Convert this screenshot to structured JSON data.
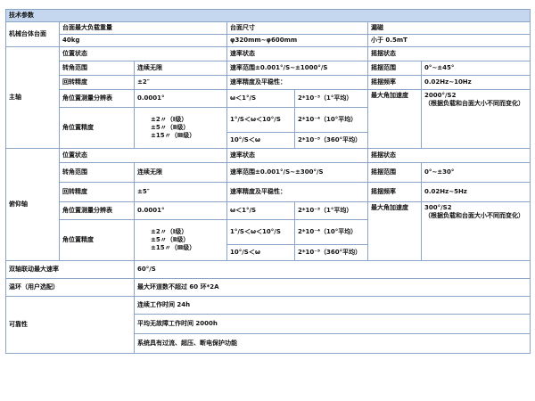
{
  "title": "技术参数",
  "mech": {
    "label": "机械台体台面",
    "load_h": "台面最大负载重量",
    "load_v": "40kg",
    "size_h": "台面尺寸",
    "size_v": "φ320mm~φ600mm",
    "mag_h": "漏磁",
    "mag_v": "小于 0.5mT"
  },
  "main": {
    "label": "主轴",
    "pos_state": "位置状态",
    "rate_state": "速率状态",
    "swing_state": "摇摆状态",
    "angle_range": "转角范围",
    "angle_range_v": "连续无限",
    "rate_range": "速率范围±0.001°/S~±1000°/S",
    "swing_range": "摇摆范围",
    "swing_range_v": "0°~±45°",
    "return_acc": "回转精度",
    "return_acc_v": "±2″",
    "rate_stab": "速率精度及平稳性：",
    "swing_freq": "摇摆频率",
    "swing_freq_v": "0.02Hz~10Hz",
    "pos_res": "角位置测量分辨表",
    "pos_res_v": "0.0001°",
    "r1_cond": "ω＜1°/S",
    "r1_val": "2*10⁻³（1°平均）",
    "max_acc": "最大角加速度",
    "max_acc_v1": "2000°/S2",
    "max_acc_v2": "（根据负载和台面大小不同而变化）",
    "pos_acc": "角位置精度",
    "pos_acc_l1": "±2〃（Ⅰ级）",
    "pos_acc_l2": "±5〃（Ⅱ级）",
    "pos_acc_l3": "±15〃（Ⅲ级）",
    "r2_cond": "1°/S＜ω＜10°/S",
    "r2_val": "2*10⁻⁴（10°平均）",
    "r3_cond": "10°/S＜ω",
    "r3_val": "2*10⁻⁵（360°平均）"
  },
  "pitch": {
    "label": "俯仰轴",
    "pos_state": "位置状态",
    "rate_state": "速率状态",
    "swing_state": "摇摆状态",
    "angle_range": "转角范围",
    "angle_range_v": "连续无限",
    "rate_range": "速率范围±0.001°/S~±300°/S",
    "swing_range": "摇摆范围",
    "swing_range_v": "0°~±30°",
    "return_acc": "回转精度",
    "return_acc_v": "±5″",
    "rate_stab": "速率精度及平稳性：",
    "swing_freq": "摇摆频率",
    "swing_freq_v": "0.02Hz~5Hz",
    "pos_res": "角位置测量分辨表",
    "pos_res_v": "0.0001°",
    "r1_cond": "ω＜1°/S",
    "r1_val": "2*10⁻³（1°平均）",
    "max_acc": "最大角加速度",
    "max_acc_v1": "300°/S2",
    "max_acc_v2": "（根据负载和台面大小不同而变化）",
    "pos_acc": "角位置精度",
    "pos_acc_l1": "±2〃（Ⅰ级）",
    "pos_acc_l2": "±5〃（Ⅱ级）",
    "pos_acc_l3": "±15〃（Ⅲ级）",
    "r2_cond": "1°/S＜ω＜10°/S",
    "r2_val": "2*10⁻⁴（10°平均）",
    "r3_cond": "10°/S＜ω",
    "r3_val": "2*10⁻⁵（360°平均）"
  },
  "dual": {
    "label": "双轴联动最大速率",
    "value": "60°/S"
  },
  "temp": {
    "label": "温环（用户选配）",
    "value": "最大环道数不超过 60 环*2A"
  },
  "rel": {
    "label": "可靠性",
    "v1": "连续工作时间 24h",
    "v2": "平均无故障工作时间 2000h",
    "v3": "系统具有过流、超压、断电保护功能"
  }
}
